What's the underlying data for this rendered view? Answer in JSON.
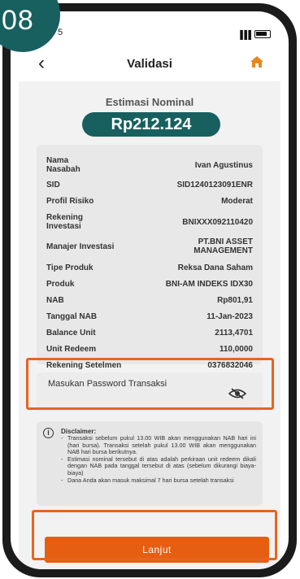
{
  "badge": {
    "step": "08"
  },
  "status": {
    "time": "5",
    "signal": "▐▐▐"
  },
  "header": {
    "back_icon": "chevron-left-icon",
    "title": "Validasi",
    "home_icon": "home-icon",
    "accent": "#E8881F"
  },
  "estimation": {
    "label": "Estimasi Nominal",
    "amount": "Rp212.124",
    "color": "#17605F"
  },
  "details": [
    {
      "label": "Nama Nasabah",
      "value": "Ivan Agustinus"
    },
    {
      "label": "SID",
      "value": "SID1240123091ENR"
    },
    {
      "label": "Profil Risiko",
      "value": "Moderat"
    },
    {
      "label": "Rekening Investasi",
      "value": "BNIXXX092110420"
    },
    {
      "label": "Manajer Investasi",
      "value": "PT.BNI ASSET MANAGEMENT"
    },
    {
      "label": "Tipe Produk",
      "value": "Reksa Dana Saham"
    },
    {
      "label": "Produk",
      "value": "BNI-AM INDEKS IDX30"
    },
    {
      "label": "NAB",
      "value": "Rp801,91"
    },
    {
      "label": "Tanggal NAB",
      "value": "11-Jan-2023"
    },
    {
      "label": "Balance Unit",
      "value": "2113,4701"
    },
    {
      "label": "Unit Redeem",
      "value": "110,0000"
    },
    {
      "label": "Rekening Setelmen",
      "value": "0376832046"
    }
  ],
  "password": {
    "label": "Masukan Password Transaksi",
    "value": "",
    "placeholder": "",
    "eye_icon": "eye-off-icon"
  },
  "disclaimer": {
    "title": "Disclaimer:",
    "items": [
      "Transaksi sebelum pukul 13.00 WIB akan menggunakan NAB hari ini (hari bursa). Transaksi setelah pukul 13.00 WIB akan menggunakan NAB hari bursa berikutnya.",
      "Estimasi nominal tersebut di atas adalah perkiraan unit redeem dikali dengan NAB pada tanggal tersebut di atas (sebelum dikurangi biaya-biaya)",
      "Dana Anda akan masuk maksimal 7 hari bursa setelah transaksi"
    ]
  },
  "actions": {
    "submit_label": "Lanjut",
    "button_color": "#E65E12",
    "highlight_color": "#E8641F"
  }
}
